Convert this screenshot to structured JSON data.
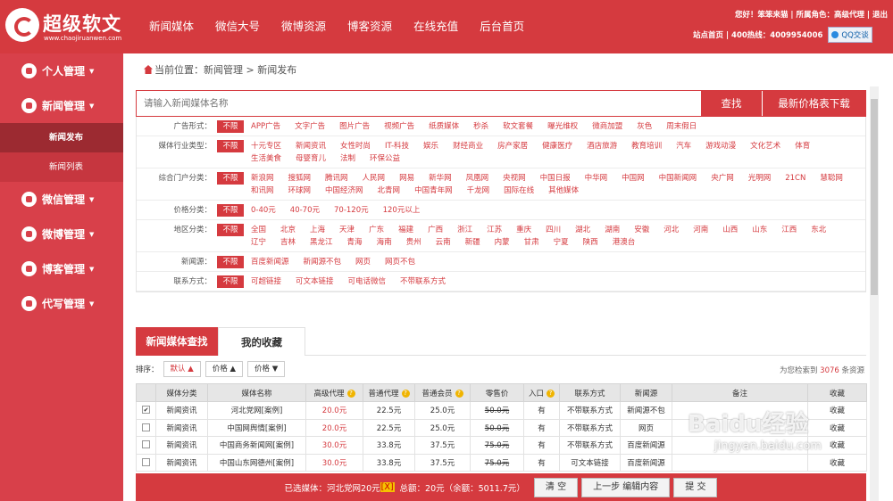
{
  "logo": {
    "title": "超级软文",
    "sub": "www.chaojiruanwen.com"
  },
  "nav": [
    "新闻媒体",
    "微信大号",
    "微博资源",
    "博客资源",
    "在线充值",
    "后台首页"
  ],
  "topright": {
    "line1": "您好！笨笨来猫 | 所属角色：高级代理 | 退出",
    "line2": "站点首页 | 400热线：4009954006",
    "qq": "QQ交谈"
  },
  "side": {
    "items": [
      "个人管理",
      "新闻管理",
      "微信管理",
      "微博管理",
      "博客管理",
      "代写管理"
    ],
    "subs": [
      "新闻发布",
      "新闻列表"
    ]
  },
  "breadcrumb": "当前位置：新闻管理 > 新闻发布",
  "search": {
    "placeholder": "请输入新闻媒体名称",
    "btn": "查找",
    "btn2": "最新价格表下载"
  },
  "filters": [
    {
      "label": "广告形式：",
      "badge": "不限",
      "opts": [
        "APP广告",
        "文字广告",
        "图片广告",
        "视频广告",
        "纸质媒体",
        "秒杀",
        "软文套餐",
        "曝光维权",
        "微商加盟",
        "灰色",
        "周末假日"
      ]
    },
    {
      "label": "媒体行业类型：",
      "badge": "不限",
      "opts": [
        "十元专区",
        "新闻资讯",
        "女性时尚",
        "IT-科技",
        "娱乐",
        "财经商业",
        "房产家居",
        "健康医疗",
        "酒店旅游",
        "教育培训",
        "汽车",
        "游戏动漫",
        "文化艺术",
        "体育",
        "生活美食",
        "母婴育儿",
        "法制",
        "环保公益"
      ]
    },
    {
      "label": "综合门户分类：",
      "badge": "不限",
      "opts": [
        "新浪网",
        "搜狐网",
        "腾讯网",
        "人民网",
        "网易",
        "新华网",
        "凤凰网",
        "央视网",
        "中国日报",
        "中华网",
        "中国网",
        "中国新闻网",
        "央广网",
        "光明网",
        "21CN",
        "慧聪网",
        "和讯网",
        "环球网",
        "中国经济网",
        "北青网",
        "中国青年网",
        "千龙网",
        "国际在线",
        "其他媒体"
      ]
    },
    {
      "label": "价格分类：",
      "badge": "不限",
      "opts": [
        "0-40元",
        "40-70元",
        "70-120元",
        "120元以上"
      ]
    },
    {
      "label": "地区分类：",
      "badge": "不限",
      "opts": [
        "全国",
        "北京",
        "上海",
        "天津",
        "广东",
        "福建",
        "广西",
        "浙江",
        "江苏",
        "重庆",
        "四川",
        "湖北",
        "湖南",
        "安徽",
        "河北",
        "河南",
        "山西",
        "山东",
        "江西",
        "东北",
        "辽宁",
        "吉林",
        "黑龙江",
        "青海",
        "海南",
        "贵州",
        "云南",
        "新疆",
        "内蒙",
        "甘肃",
        "宁夏",
        "陕西",
        "港澳台"
      ]
    },
    {
      "label": "新闻源：",
      "badge": "不限",
      "opts": [
        "百度新闻源",
        "新闻源不包",
        "网页",
        "网页不包"
      ]
    },
    {
      "label": "联系方式：",
      "badge": "不限",
      "opts": [
        "可超链接",
        "可文本链接",
        "可电话微信",
        "不带联系方式"
      ]
    }
  ],
  "tabs": [
    "新闻媒体查找",
    "我的收藏"
  ],
  "sort": {
    "label": "排序：",
    "b1": "默认",
    "b2": "价格",
    "b3": "价格",
    "count_pre": "为您检索到 ",
    "count": "3076",
    "count_post": " 条资源"
  },
  "table": {
    "headers": [
      "",
      "媒体分类",
      "媒体名称",
      "高级代理",
      "普通代理",
      "普通会员",
      "零售价",
      "入口",
      "联系方式",
      "新闻源",
      "备注",
      "收藏"
    ],
    "rows": [
      [
        "✔",
        "新闻资讯",
        "河北党网[案例]",
        "20.0元",
        "22.5元",
        "25.0元",
        "50.0元",
        "有",
        "不带联系方式",
        "新闻源不包",
        "",
        "收藏"
      ],
      [
        "",
        "新闻资讯",
        "中国网舆情[案例]",
        "20.0元",
        "22.5元",
        "25.0元",
        "50.0元",
        "有",
        "不带联系方式",
        "网页",
        "",
        "收藏"
      ],
      [
        "",
        "新闻资讯",
        "中国商务新闻网[案例]",
        "30.0元",
        "33.8元",
        "37.5元",
        "75.0元",
        "有",
        "不带联系方式",
        "百度新闻源",
        "",
        "收藏"
      ],
      [
        "",
        "新闻资讯",
        "中国山东网德州[案例]",
        "30.0元",
        "33.8元",
        "37.5元",
        "75.0元",
        "有",
        "可文本链接",
        "百度新闻源",
        "",
        "收藏"
      ]
    ]
  },
  "footer": {
    "sel": "已选媒体：河北党网20元",
    "x": "[X]",
    "total": "总额：20元（余额：5011.7元）",
    "b1": "清 空",
    "b2": "上一步 编辑内容",
    "b3": "提 交"
  },
  "watermark": {
    "l1": "Baidu经验",
    "l2": "jingyan.baidu.com"
  }
}
